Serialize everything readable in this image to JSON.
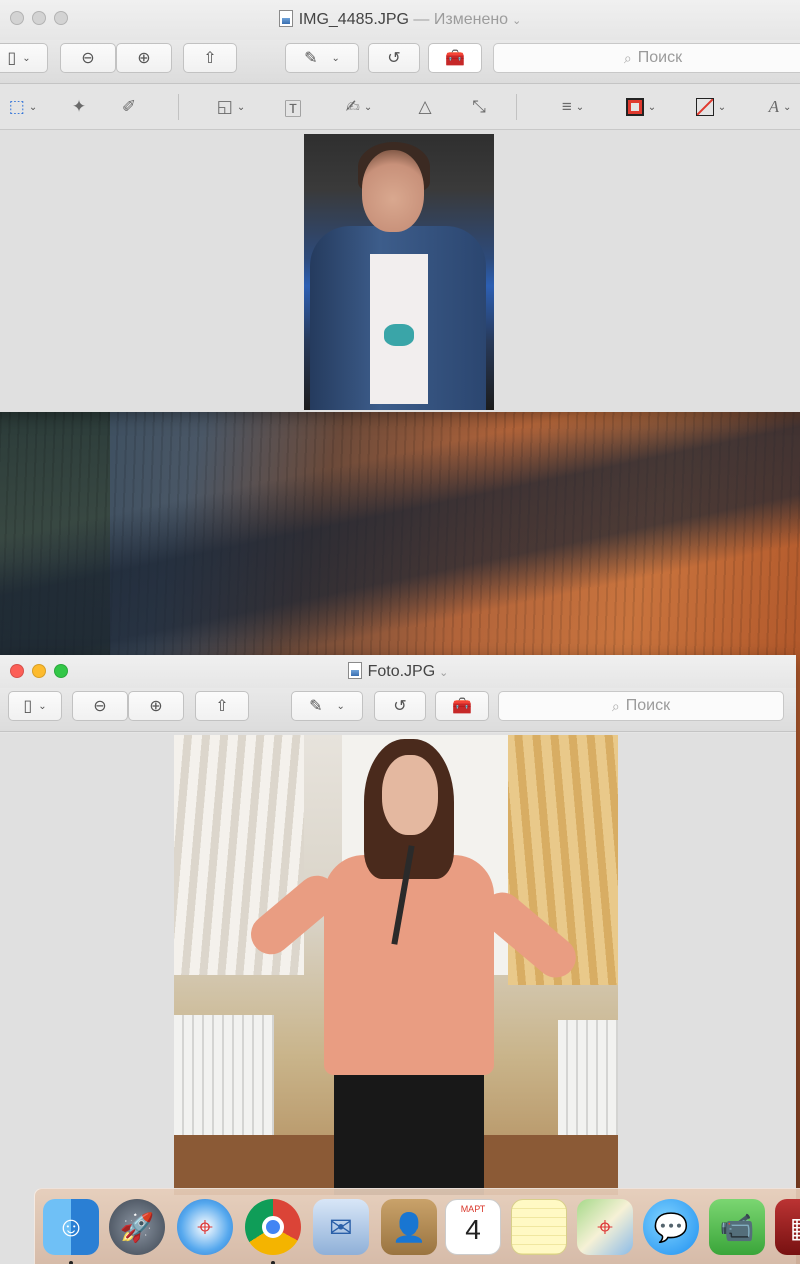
{
  "windows": {
    "top": {
      "title": "IMG_4485.JPG",
      "edited_label": "— Изменено",
      "search_placeholder": "Поиск"
    },
    "bottom": {
      "title": "Foto.JPG",
      "search_placeholder": "Поиск"
    }
  },
  "markup_tools": [
    "rectangular-selection",
    "instant-alpha",
    "sketch",
    "shapes",
    "text",
    "sign",
    "adjust-color",
    "adjust-size",
    "shape-style",
    "border-color",
    "fill-color",
    "text-style"
  ],
  "dock": {
    "calendar_month": "МАРТ",
    "calendar_day": "4",
    "apps": [
      "Finder",
      "Launchpad",
      "Safari",
      "Chrome",
      "Mail",
      "Contacts",
      "Calendar",
      "Notes",
      "Maps",
      "Messages",
      "FaceTime",
      "Photo Booth"
    ]
  }
}
